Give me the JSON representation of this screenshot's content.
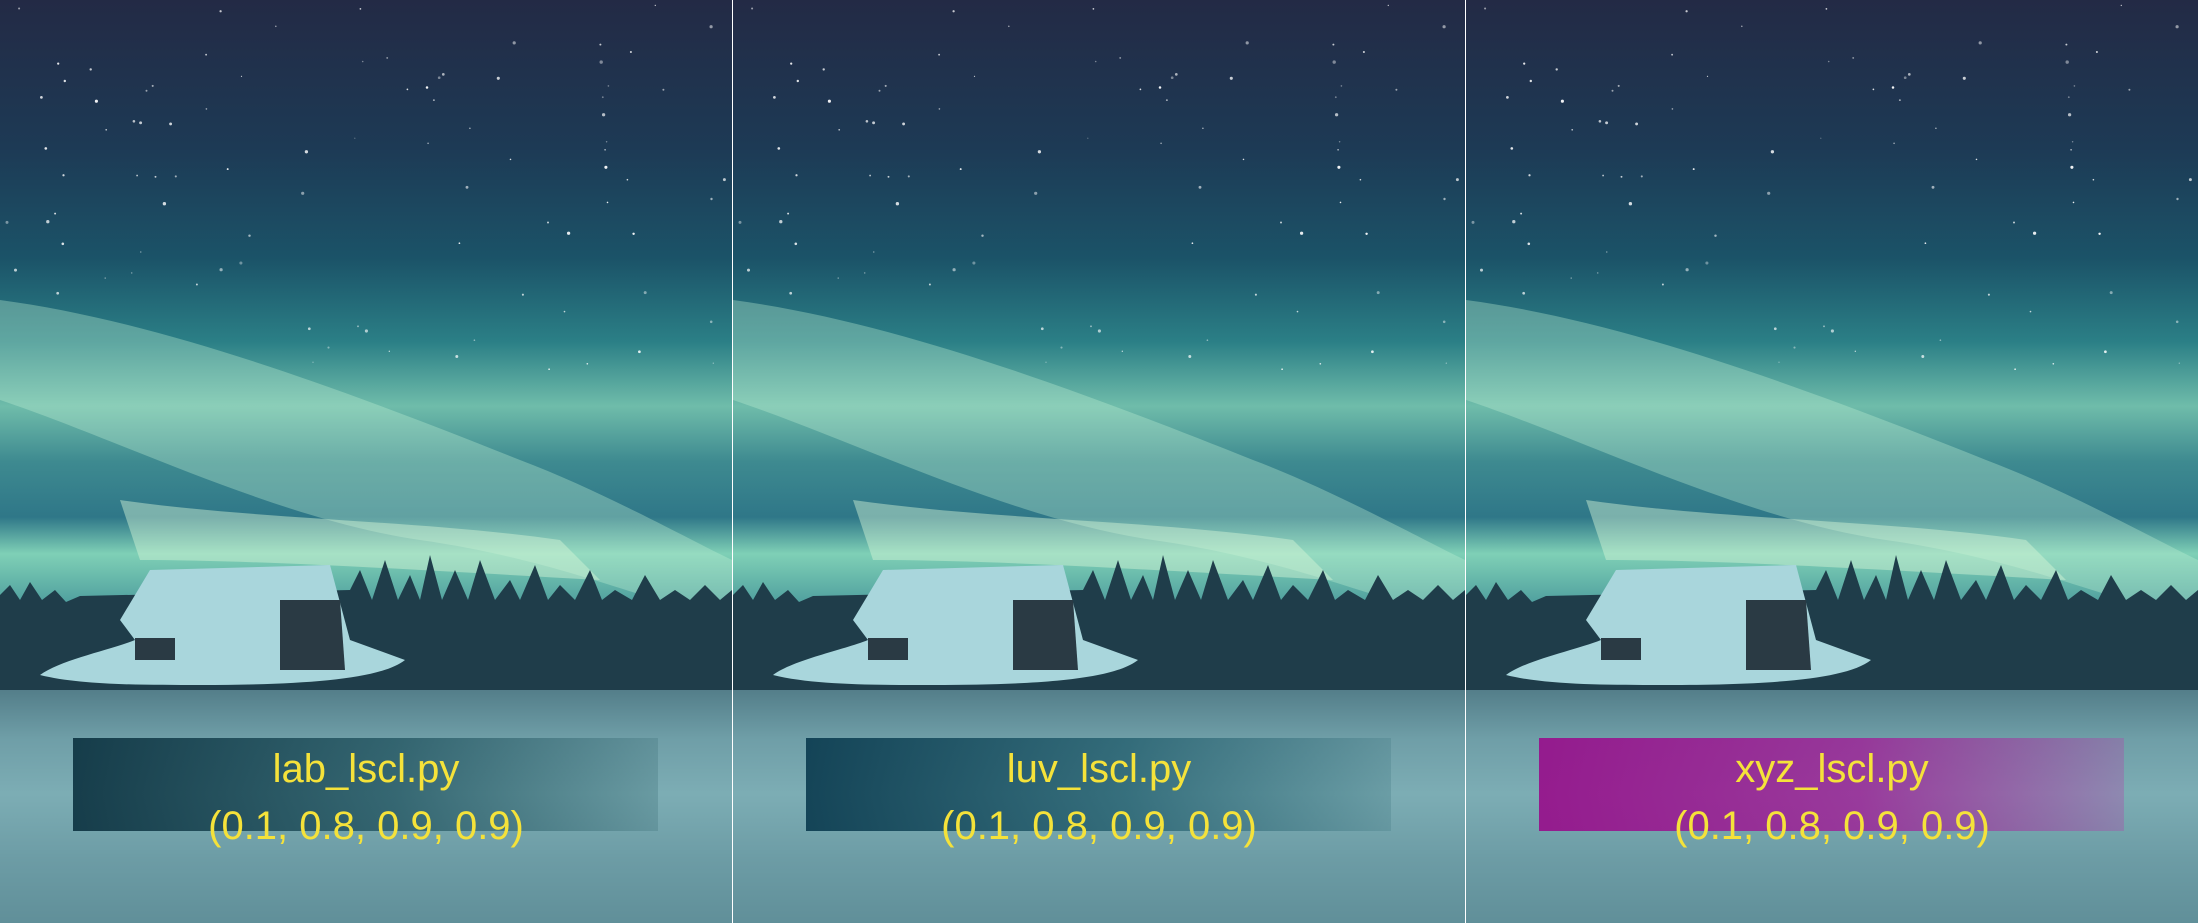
{
  "panels": [
    {
      "name": "lab_lscl.py",
      "values": "(0.1, 0.8, 0.9, 0.9)",
      "swatch_color": "#0e3442"
    },
    {
      "name": "luv_lscl.py",
      "values": "(0.1, 0.8, 0.9, 0.9)",
      "swatch_color": "#0c3c50"
    },
    {
      "name": "xyz_lscl.py",
      "values": "(0.1, 0.8, 0.9, 0.9)",
      "swatch_color": "#96148c"
    }
  ],
  "colors": {
    "caption_text": "#f5e23a",
    "sky_top": "#232a45",
    "aurora": "#7fd0b6",
    "snow": "#8dbfc4"
  }
}
